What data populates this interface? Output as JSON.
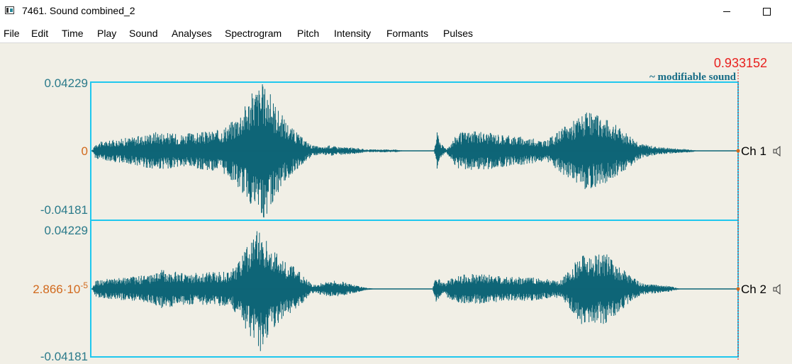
{
  "window": {
    "title": "7461. Sound combined_2"
  },
  "menu": [
    "File",
    "Edit",
    "Time",
    "Play",
    "Sound",
    "Analyses",
    "Spectrogram",
    "Pitch",
    "Intensity",
    "Formants",
    "Pulses"
  ],
  "editor": {
    "cursor_time": "0.933152",
    "modifiable_label": "~ modifiable sound",
    "channels": [
      {
        "name": "Ch 1",
        "top_value": "0.04229",
        "center_value": "0",
        "bottom_value": "-0.04181"
      },
      {
        "name": "Ch 2",
        "top_value": "0.04229",
        "center_value": "2.866·10",
        "center_exponent": "-5",
        "bottom_value": "-0.04181"
      }
    ]
  },
  "colors": {
    "waveform": "#0e6577",
    "frame": "#1fc7ee",
    "axis_label": "#2a7a8a",
    "center_label": "#d1691c",
    "cursor_time": "#e8201e"
  }
}
